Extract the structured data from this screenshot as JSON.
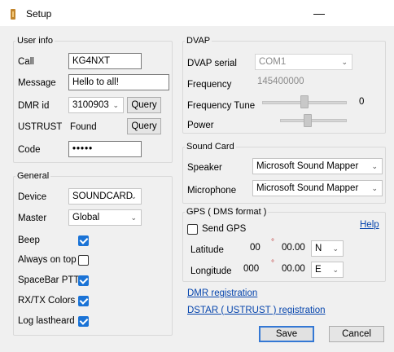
{
  "window": {
    "title": "Setup",
    "minimize": "—"
  },
  "user_info": {
    "legend": "User info",
    "call_label": "Call",
    "call_value": "KG4NXT",
    "message_label": "Message",
    "message_value": "Hello to all!",
    "dmrid_label": "DMR id",
    "dmrid_value": "3100903",
    "dmrid_query": "Query",
    "ustrust_label": "USTRUST",
    "ustrust_status": "Found",
    "ustrust_query": "Query",
    "code_label": "Code",
    "code_value": "•••••"
  },
  "general": {
    "legend": "General",
    "device_label": "Device",
    "device_value": "SOUNDCARD",
    "master_label": "Master",
    "master_value": "Global",
    "beep_label": "Beep",
    "beep_checked": true,
    "always_on_top_label": "Always on top",
    "always_on_top_checked": false,
    "spacebar_ptt_label": "SpaceBar PTT",
    "spacebar_ptt_checked": true,
    "rxtx_colors_label": "RX/TX Colors",
    "rxtx_colors_checked": true,
    "log_lastheard_label": "Log lastheard",
    "log_lastheard_checked": true
  },
  "dvap": {
    "legend": "DVAP",
    "serial_label": "DVAP serial",
    "serial_value": "COM1",
    "frequency_label": "Frequency",
    "frequency_value": "145400000",
    "frequency_tune_label": "Frequency Tune",
    "frequency_tune_value": "0",
    "power_label": "Power"
  },
  "sound_card": {
    "legend": "Sound Card",
    "speaker_label": "Speaker",
    "speaker_value": "Microsoft Sound Mapper",
    "microphone_label": "Microphone",
    "microphone_value": "Microsoft Sound Mapper"
  },
  "gps": {
    "legend": "GPS ( DMS format )",
    "send_gps_label": "Send GPS",
    "send_gps_checked": false,
    "help_link": "Help",
    "latitude_label": "Latitude",
    "lat_deg": "00",
    "lat_deg_mark": "°",
    "lat_min": "00.00",
    "lat_dir": "N",
    "longitude_label": "Longitude",
    "lon_deg": "000",
    "lon_deg_mark": "°",
    "lon_min": "00.00",
    "lon_dir": "E"
  },
  "links": {
    "dmr_registration": "DMR registration",
    "dstar_registration": "DSTAR ( USTRUST ) registration"
  },
  "buttons": {
    "save": "Save",
    "cancel": "Cancel"
  },
  "icons": {
    "app": "app-icon",
    "chevron": "chevron-down-icon",
    "check": "check-icon"
  },
  "colors": {
    "accent": "#1a73d6",
    "link": "#0645ad"
  }
}
